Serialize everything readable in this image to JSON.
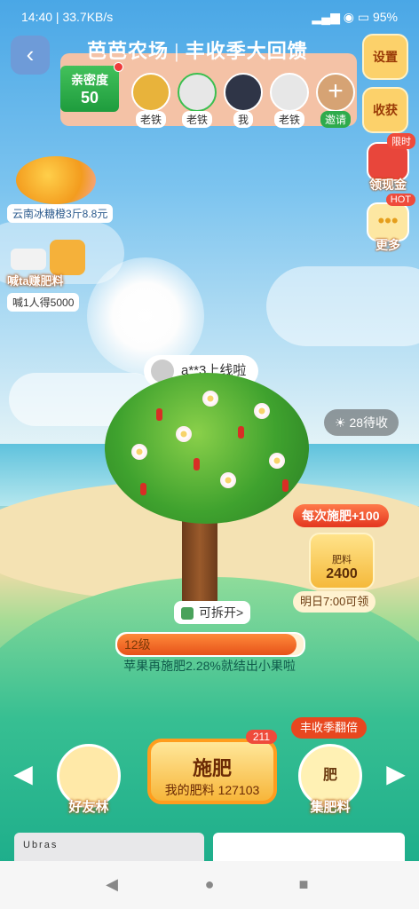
{
  "status_bar": {
    "time": "14:40 | 33.7KB/s",
    "right": "95"
  },
  "header": {
    "title_left": "芭芭农场",
    "separator": "|",
    "title_right": "丰收季大回馈"
  },
  "intimacy": {
    "label": "亲密度",
    "value": "50"
  },
  "friends": [
    {
      "tag": "老铁"
    },
    {
      "tag": "老铁"
    },
    {
      "tag": "我"
    },
    {
      "tag": "老铁"
    }
  ],
  "invite": {
    "label": "邀请",
    "icon": "+"
  },
  "side_buttons": {
    "settings": "设置",
    "harvest": "收获"
  },
  "side_icons": {
    "cash": {
      "label": "领现金",
      "badge": "限时"
    },
    "more": {
      "label": "更多",
      "badge": "HOT"
    }
  },
  "promos": {
    "orange": "云南冰糖橙3斤8.8元",
    "shout_title": "喊ta赚肥料",
    "shout_caption": "喊1人得5000"
  },
  "online": {
    "text": "a**3上线啦"
  },
  "harvest_pending": {
    "text": "28待收"
  },
  "bonus": {
    "text": "每次施肥+100"
  },
  "fert_box": {
    "label": "肥料",
    "value": "2400"
  },
  "tomorrow": {
    "text": "明日7:00可领"
  },
  "openable": {
    "text": "可拆开>"
  },
  "level": {
    "label": "12级",
    "progress": 0.96
  },
  "level_hint": "苹果再施肥2.28%就结出小果啦",
  "bottom": {
    "friends_forest": "好友林",
    "fertilize_title": "施肥",
    "fertilize_sub": "我的肥料 127103",
    "fertilize_count": "211",
    "double_tag": "丰收季翻倍",
    "collect": "集肥料",
    "collect_icon_text": "肥"
  },
  "ad": {
    "brand": "Ubras"
  },
  "nav": {
    "back": "◀",
    "home": "●",
    "recent": "■"
  }
}
